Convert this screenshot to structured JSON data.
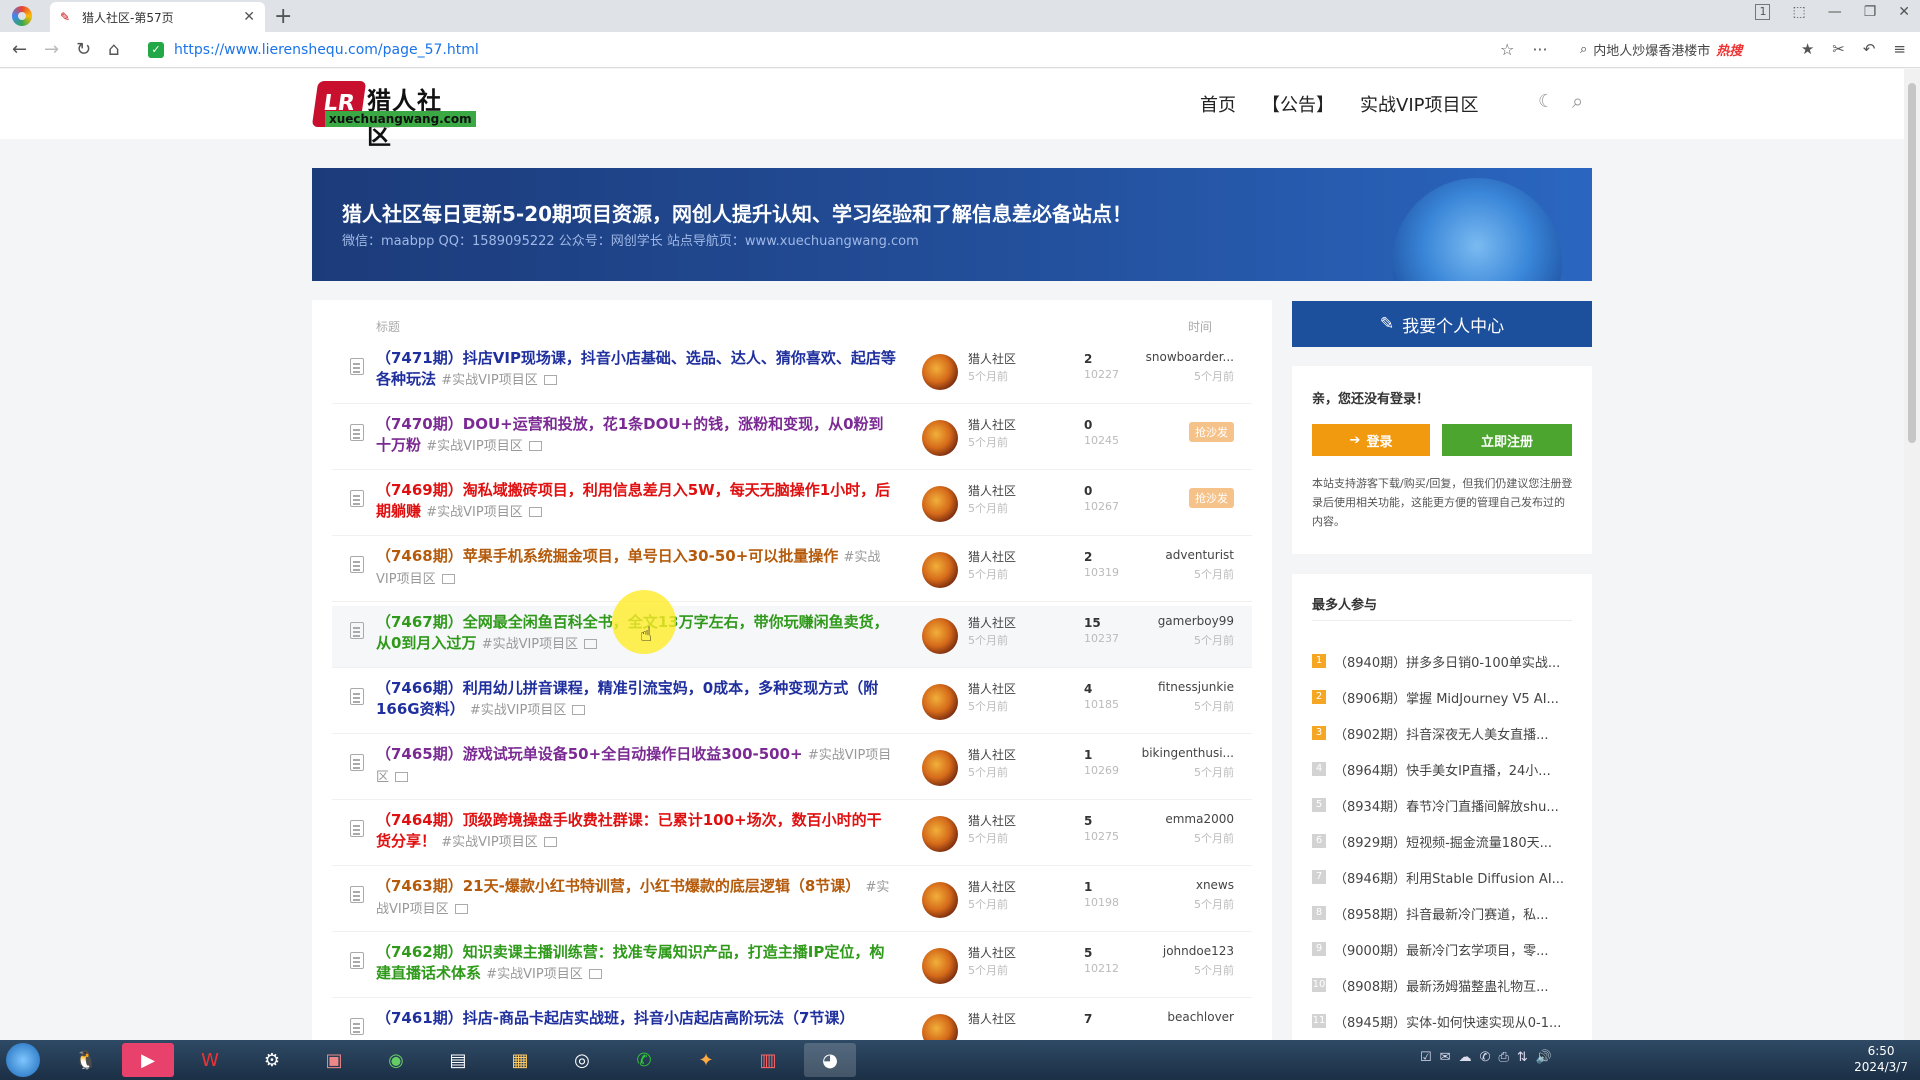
{
  "browser": {
    "tab_title": "猎人社区-第57页",
    "url": "https://www.lierenshequ.com/page_57.html",
    "search_hint": "内地人炒爆香港楼市",
    "search_hot": "热搜",
    "tab_badge": "1"
  },
  "site": {
    "logo_mark": "LR",
    "logo_title": "猎人社区",
    "logo_sub": "xuechuangwang.com",
    "nav": [
      "首页",
      "【公告】",
      "实战VIP项目区"
    ]
  },
  "banner": {
    "title": "猎人社区每日更新5-20期项目资源，网创人提升认知、学习经验和了解信息差必备站点！",
    "subtitle": "微信：maabpp QQ：1589095222 公众号：网创学长 站点导航页：www.xuechuangwang.com"
  },
  "list": {
    "header_title": "标题",
    "header_time": "时间",
    "rows": [
      {
        "title": "（7471期）抖店VIP现场课，抖音小店基础、选品、达人、猜你喜欢、起店等各种玩法",
        "color": "blue",
        "tag": "#实战VIP项目区",
        "author": "猎人社区",
        "ago": "5个月前",
        "replies": "2",
        "views": "10227",
        "last_user": "snowboarder...",
        "last_ago": "5个月前"
      },
      {
        "title": "（7470期）DOU+运营和投放，花1条DOU+的钱，涨粉和变现，从0粉到十万粉",
        "color": "purple",
        "tag": "#实战VIP项目区",
        "author": "猎人社区",
        "ago": "5个月前",
        "replies": "0",
        "views": "10245",
        "badge": "抢沙发"
      },
      {
        "title": "（7469期）淘私域搬砖项目，利用信息差月入5W，每天无脑操作1小时，后期躺赚",
        "color": "red",
        "tag": "#实战VIP项目区",
        "author": "猎人社区",
        "ago": "5个月前",
        "replies": "0",
        "views": "10267",
        "badge": "抢沙发"
      },
      {
        "title": "（7468期）苹果手机系统掘金项目，单号日入30-50+可以批量操作",
        "color": "brown",
        "tag": "#实战VIP项目区",
        "author": "猎人社区",
        "ago": "5个月前",
        "replies": "2",
        "views": "10319",
        "last_user": "adventurist",
        "last_ago": "5个月前"
      },
      {
        "title": "（7467期）全网最全闲鱼百科全书，全文13万字左右，带你玩赚闲鱼卖货，从0到月入过万",
        "color": "green",
        "tag": "#实战VIP项目区",
        "author": "猎人社区",
        "ago": "5个月前",
        "replies": "15",
        "views": "10237",
        "last_user": "gamerboy99",
        "last_ago": "5个月前"
      },
      {
        "title": "（7466期）利用幼儿拼音课程，精准引流宝妈，0成本，多种变现方式（附166G资料）",
        "color": "blue",
        "tag": "#实战VIP项目区",
        "author": "猎人社区",
        "ago": "5个月前",
        "replies": "4",
        "views": "10185",
        "last_user": "fitnessjunkie",
        "last_ago": "5个月前"
      },
      {
        "title": "（7465期）游戏试玩单设备50+全自动操作日收益300-500+",
        "color": "purple",
        "tag": "#实战VIP项目区",
        "author": "猎人社区",
        "ago": "5个月前",
        "replies": "1",
        "views": "10269",
        "last_user": "bikingenthusi...",
        "last_ago": "5个月前"
      },
      {
        "title": "（7464期）顶级跨境操盘手收费社群课：已累计100+场次，数百小时的干货分享！",
        "color": "red",
        "tag": "#实战VIP项目区",
        "author": "猎人社区",
        "ago": "5个月前",
        "replies": "5",
        "views": "10275",
        "last_user": "emma2000",
        "last_ago": "5个月前"
      },
      {
        "title": "（7463期）21天-爆款小红书特训营，小红书爆款的底层逻辑（8节课）",
        "color": "brown",
        "tag": "#实战VIP项目区",
        "author": "猎人社区",
        "ago": "5个月前",
        "replies": "1",
        "views": "10198",
        "last_user": "xnews",
        "last_ago": "5个月前"
      },
      {
        "title": "（7462期）知识卖课主播训练营：找准专属知识产品，打造主播IP定位，构建直播话术体系",
        "color": "green",
        "tag": "#实战VIP项目区",
        "author": "猎人社区",
        "ago": "5个月前",
        "replies": "5",
        "views": "10212",
        "last_user": "johndoe123",
        "last_ago": "5个月前"
      },
      {
        "title": "（7461期）抖店-商品卡起店实战班，抖音小店起店高阶玩法（7节课）",
        "color": "blue",
        "tag": "",
        "author": "猎人社区",
        "ago": "",
        "replies": "7",
        "views": "",
        "last_user": "beachlover",
        "last_ago": ""
      }
    ]
  },
  "sidebar": {
    "user_center": "我要个人中心",
    "hello": "亲，您还没有登录！",
    "login": "登录",
    "register": "立即注册",
    "note": "本站支持游客下载/购买/回复，但我们仍建议您注册登录后使用相关功能，这能更方便的管理自己发布过的内容。",
    "hot_title": "最多人参与",
    "hot_items": [
      "（8940期）拼多多日销0-100单实战...",
      "（8906期）掌握 MidJourney V5 AI...",
      "（8902期）抖音深夜无人美女直播...",
      "（8964期）快手美女IP直播，24小...",
      "（8934期）春节冷门直播间解放shu...",
      "（8929期）短视频-掘金流量180天...",
      "（8946期）利用Stable Diffusion AI...",
      "（8958期）抖音最新冷门赛道，私...",
      "（9000期）最新冷门玄学项目，零...",
      "（8908期）最新汤姆猫整蛊礼物互...",
      "（8945期）实体-如何快速实现从0-1..."
    ]
  },
  "taskbar": {
    "time": "6:50",
    "date": "2024/3/7"
  }
}
